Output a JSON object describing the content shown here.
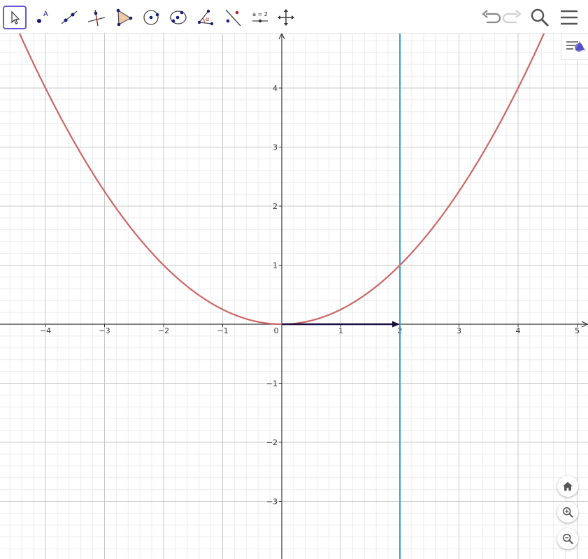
{
  "toolbar": {
    "tools": [
      {
        "name": "move-tool",
        "label": ""
      },
      {
        "name": "point-tool",
        "label": "A"
      },
      {
        "name": "line-tool",
        "label": ""
      },
      {
        "name": "perpendicular-line-tool",
        "label": ""
      },
      {
        "name": "polygon-tool",
        "label": ""
      },
      {
        "name": "circle-center-tool",
        "label": ""
      },
      {
        "name": "circle-three-points-tool",
        "label": ""
      },
      {
        "name": "angle-tool",
        "label": "α"
      },
      {
        "name": "reflect-tool",
        "label": ""
      },
      {
        "name": "slider-tool",
        "label": "a = 2"
      },
      {
        "name": "move-graphics-view-tool",
        "label": ""
      }
    ],
    "active_tool": "move-tool",
    "right_icons": [
      "undo-icon",
      "redo-icon",
      "search-icon",
      "menu-icon"
    ]
  },
  "graph": {
    "x_ticks": [
      "−4",
      "−3",
      "−2",
      "−1",
      "0",
      "1",
      "2",
      "3",
      "4",
      "5"
    ],
    "y_ticks": [
      "4",
      "3",
      "2",
      "1",
      "−1",
      "−2",
      "−3"
    ],
    "parabola_color": "#cc6666",
    "vertical_line_color": "#3c9fd6",
    "vector_color": "#1a1040",
    "grid_major_color": "#c8c8c8",
    "grid_minor_color": "#ececec"
  },
  "chart_data": {
    "type": "line",
    "series": [
      {
        "function": "y = x^2 / 4",
        "x": [
          -4,
          -2,
          0,
          2,
          4
        ],
        "y": [
          4,
          1,
          0,
          1,
          4
        ]
      },
      {
        "function": "x = 2",
        "x": [
          2,
          2
        ],
        "y": [
          -4,
          5
        ]
      },
      {
        "vector": true,
        "from": [
          0,
          0
        ],
        "to": [
          2,
          0
        ]
      }
    ],
    "xlim": [
      -4.7,
      5.0
    ],
    "ylim": [
      -4.0,
      4.9
    ],
    "grid": true
  },
  "controls": {
    "icons": [
      "style-bar-icon",
      "home-icon",
      "zoom-in-icon",
      "zoom-out-icon"
    ]
  }
}
